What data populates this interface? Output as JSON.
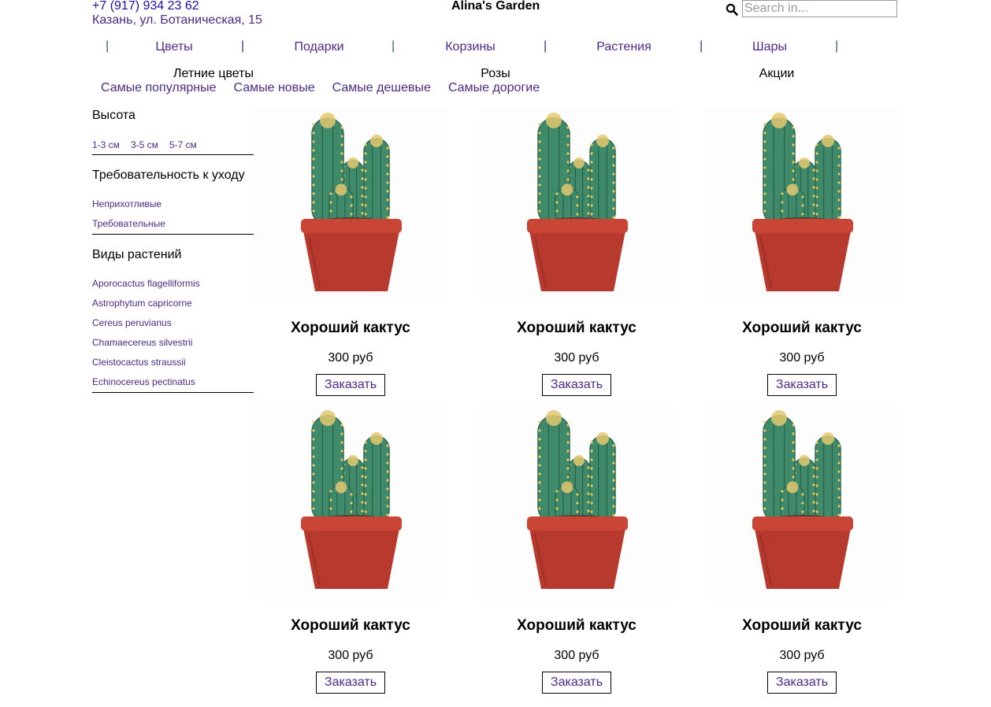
{
  "header": {
    "phone": "+7 (917) 934 23 62",
    "address": "Казань, ул. Ботаническая, 15",
    "brand": "Alina's Garden",
    "search": {
      "placeholder": "Search in...",
      "icon": "search-icon"
    }
  },
  "nav": {
    "separator": "|",
    "items": [
      "Цветы",
      "Подарки",
      "Корзины",
      "Растения",
      "Шары"
    ]
  },
  "subnav": [
    "Летние цветы",
    "Розы",
    "Акции"
  ],
  "sort": [
    "Самые популярные",
    "Самые новые",
    "Самые дешевые",
    "Самые дорогие"
  ],
  "filters": {
    "height": {
      "title": "Высота",
      "options": [
        "1-3 см",
        "3-5 см",
        "5-7 см"
      ]
    },
    "care": {
      "title": "Требовательность к уходу",
      "options": [
        "Неприхотливые",
        "Требовательные"
      ]
    },
    "species": {
      "title": "Виды растений",
      "options": [
        "Aporocactus flagelliformis",
        "Astrophytum capricorne",
        "Cereus peruvianus",
        "Chamaecereus silvestrii",
        "Cleistocactus straussii",
        "Echinocereus pectinatus"
      ]
    }
  },
  "products": [
    {
      "name": "Хороший кактус",
      "price": "300 руб",
      "button": "Заказать"
    },
    {
      "name": "Хороший кактус",
      "price": "300 руб",
      "button": "Заказать"
    },
    {
      "name": "Хороший кактус",
      "price": "300 руб",
      "button": "Заказать"
    },
    {
      "name": "Хороший кактус",
      "price": "300 руб",
      "button": "Заказать"
    },
    {
      "name": "Хороший кактус",
      "price": "300 руб",
      "button": "Заказать"
    },
    {
      "name": "Хороший кактус",
      "price": "300 руб",
      "button": "Заказать"
    }
  ],
  "colors": {
    "link": "#4b2a8a",
    "phone": "#1a0dab",
    "separator": "#2e6e3a",
    "pot": "#b83a2e",
    "cactus": "#3f8a6a"
  }
}
